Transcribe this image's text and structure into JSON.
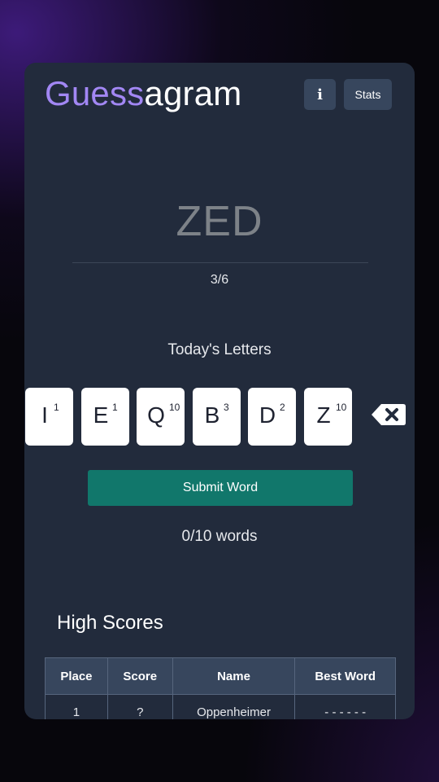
{
  "header": {
    "title_accent": "Guess",
    "title_rest": "agram",
    "info_label": "i",
    "stats_label": "Stats"
  },
  "guess": {
    "current_word": "ZED",
    "attempts": "3/6"
  },
  "letters": {
    "heading": "Today's Letters",
    "tiles": [
      {
        "letter": "I",
        "points": "1"
      },
      {
        "letter": "E",
        "points": "1"
      },
      {
        "letter": "Q",
        "points": "10"
      },
      {
        "letter": "B",
        "points": "3"
      },
      {
        "letter": "D",
        "points": "2"
      },
      {
        "letter": "Z",
        "points": "10"
      }
    ],
    "backspace_icon": "backspace-icon"
  },
  "submit_label": "Submit Word",
  "word_count": "0/10 words",
  "high_scores": {
    "heading": "High Scores",
    "columns": [
      "Place",
      "Score",
      "Name",
      "Best Word"
    ],
    "rows": [
      [
        "1",
        "?",
        "Oppenheimer",
        "- - - - - -"
      ]
    ]
  },
  "colors": {
    "accent": "#a287f4",
    "card": "#222b3c",
    "button": "#37465d",
    "submit": "#11776b"
  }
}
